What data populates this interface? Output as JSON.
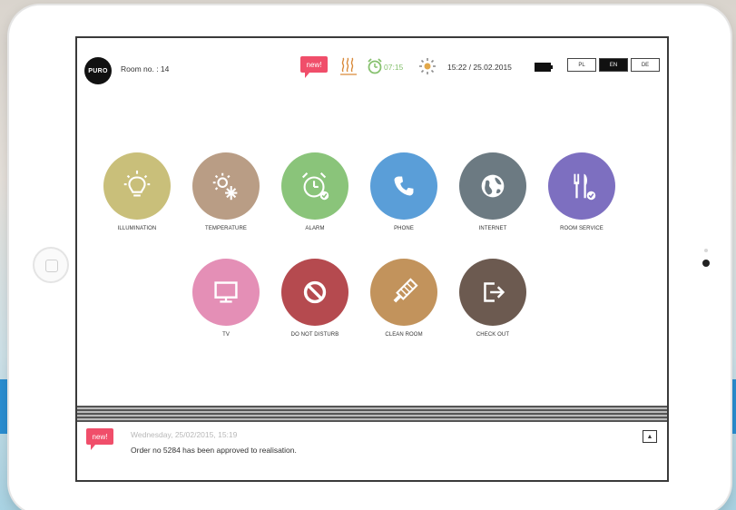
{
  "header": {
    "logo_text": "PURO",
    "room_label": "Room no. : 14",
    "new_badge": "new!",
    "alarm_time": "07:15",
    "datetime": "15:22 / 25.02.2015",
    "languages": [
      "PL",
      "EN",
      "DE"
    ],
    "active_language": "EN"
  },
  "tiles_row1": [
    {
      "label": "ILLUMINATION",
      "color": "#c9bf7a",
      "icon": "light-bulb-icon"
    },
    {
      "label": "TEMPERATURE",
      "color": "#b99d85",
      "icon": "temperature-icon"
    },
    {
      "label": "ALARM",
      "color": "#8ac47a",
      "icon": "alarm-clock-icon"
    },
    {
      "label": "PHONE",
      "color": "#5a9ed8",
      "icon": "phone-icon"
    },
    {
      "label": "INTERNET",
      "color": "#6c7a82",
      "icon": "globe-icon"
    },
    {
      "label": "ROOM SERVICE",
      "color": "#7d6fc0",
      "icon": "cutlery-icon"
    }
  ],
  "tiles_row2": [
    {
      "label": "TV",
      "color": "#e48fb6",
      "icon": "tv-icon"
    },
    {
      "label": "DO NOT DISTURB",
      "color": "#b54a4f",
      "icon": "no-entry-icon"
    },
    {
      "label": "CLEAN ROOM",
      "color": "#c2935c",
      "icon": "brush-icon"
    },
    {
      "label": "CHECK OUT",
      "color": "#6c5a50",
      "icon": "exit-icon"
    }
  ],
  "notification": {
    "badge": "new!",
    "date": "Wednesday, 25/02/2015, 15:19",
    "message": "Order no 5284 has been approved to realisation."
  }
}
